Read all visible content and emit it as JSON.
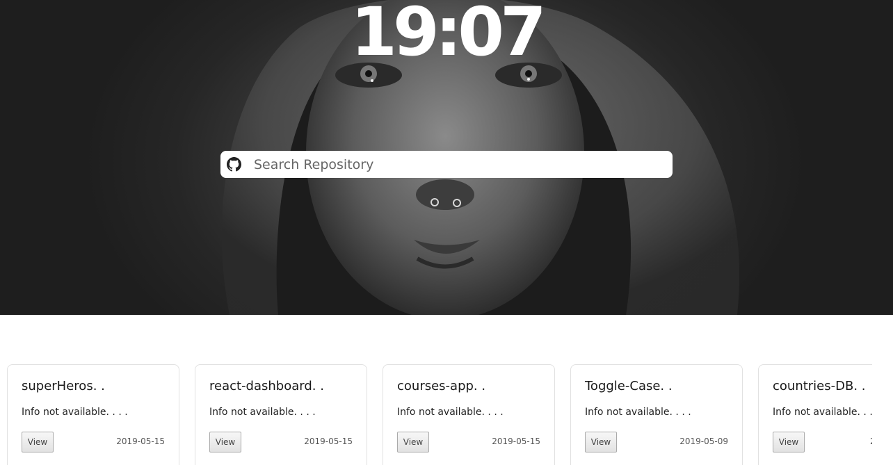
{
  "clock": {
    "time": "19:07"
  },
  "search": {
    "placeholder": "Search Repository",
    "value": ""
  },
  "cards": [
    {
      "title": "superHeros. .",
      "info": "Info not available. . . .",
      "button": "View",
      "date": "2019-05-15"
    },
    {
      "title": "react-dashboard. .",
      "info": "Info not available. . . .",
      "button": "View",
      "date": "2019-05-15"
    },
    {
      "title": "courses-app. .",
      "info": "Info not available. . . .",
      "button": "View",
      "date": "2019-05-15"
    },
    {
      "title": "Toggle-Case. .",
      "info": "Info not available. . . .",
      "button": "View",
      "date": "2019-05-09"
    },
    {
      "title": "countries-DB. .",
      "info": "Info not available. . . .",
      "button": "View",
      "date": "2"
    }
  ],
  "icons": {
    "search_prefix": "github-icon"
  }
}
